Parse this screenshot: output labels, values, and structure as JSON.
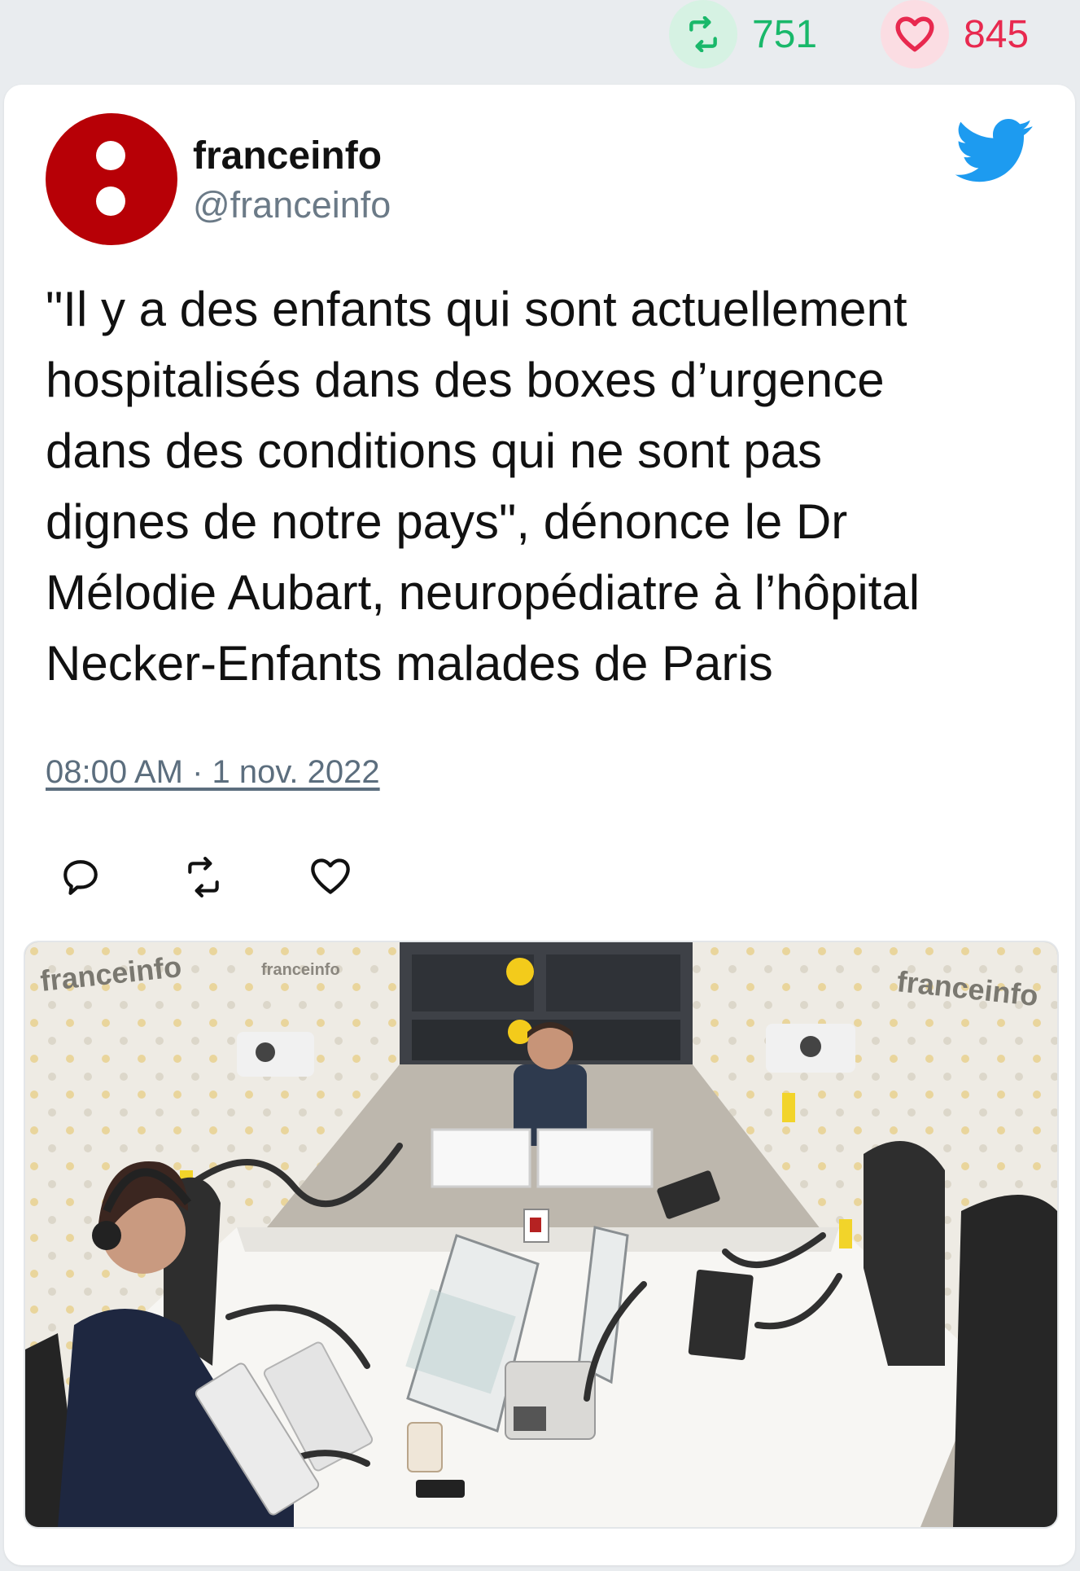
{
  "stats": {
    "retweets": "751",
    "likes": "845",
    "retweet_icon": "retweet-icon",
    "like_icon": "heart-icon"
  },
  "tweet": {
    "author_name": "franceinfo",
    "author_handle": "@franceinfo",
    "lines": [
      "\"Il y a des enfants qui sont actuellement",
      "hospitalisés dans des boxes d’urgence",
      "dans des conditions qui ne sont pas",
      "dignes de notre pays\", dénonce le Dr",
      "Mélodie Aubart, neuropédiatre à l’hôpital",
      "Necker-Enfants malades de Paris"
    ],
    "timestamp": "08:00 AM · 1 nov. 2022"
  },
  "media": {
    "wall_logo_text": "franceinfo"
  },
  "colors": {
    "retweet_green": "#19b86a",
    "like_red": "#e8294f",
    "twitter_blue": "#1d9bf0",
    "avatar_red": "#b70006"
  }
}
